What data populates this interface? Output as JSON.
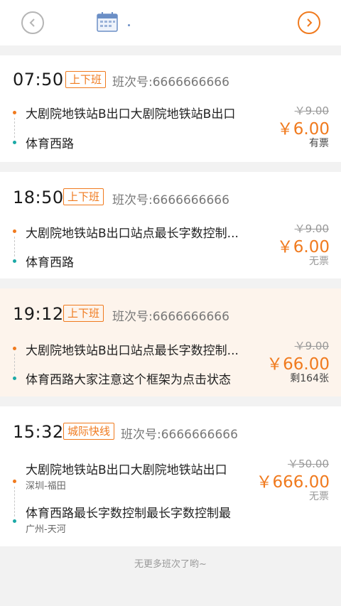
{
  "header": {
    "prev_icon": "chevron-left-icon",
    "calendar_icon": "calendar-icon",
    "next_icon": "chevron-right-icon",
    "accent": "#f07a1e"
  },
  "trips": [
    {
      "time": "07:50",
      "tag": "上下班",
      "bus_no": "班次号:6666666666",
      "from": "大剧院地铁站B出口大剧院地铁站B出口",
      "to": "体育西路",
      "old_price": "￥9.00",
      "price": "￥6.00",
      "stock": "有票"
    },
    {
      "time": "18:50",
      "tag": "上下班",
      "bus_no": "班次号:6666666666",
      "from": "大剧院地铁站B出口站点最长字数控制...",
      "to": "体育西路",
      "old_price": "￥9.00",
      "price": "￥6.00",
      "stock": "无票"
    },
    {
      "time": "19:12",
      "tag": "上下班",
      "bus_no": "班次号:6666666666",
      "from": "大剧院地铁站B出口站点最长字数控制...",
      "to": "体育西路大家注意这个框架为点击状态",
      "old_price": "￥9.00",
      "price": "￥66.00",
      "stock": "剩164张"
    },
    {
      "time": "15:32",
      "tag": "城际快线",
      "bus_no": "班次号:6666666666",
      "from": "大剧院地铁站B出口大剧院地铁站出口",
      "from_sub": "深圳-福田",
      "to": "体育西路最长字数控制最长字数控制最",
      "to_sub": "广州-天河",
      "old_price": "￥50.00",
      "price": "￥666.00",
      "stock": "无票"
    }
  ],
  "footer_text": "无更多班次了哟~"
}
